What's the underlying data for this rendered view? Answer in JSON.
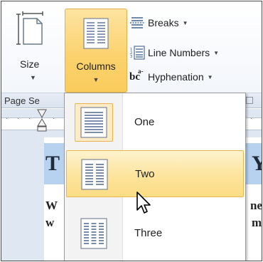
{
  "ribbon": {
    "size_label": "Size",
    "columns_label": "Columns",
    "breaks_label": "Breaks",
    "line_numbers_label": "Line Numbers",
    "hyphenation_label": "Hyphenation",
    "hyphenation_icon_text": "bc",
    "hyphenation_icon_sup": "a-",
    "group_label": "Page Se"
  },
  "columns_menu": {
    "items": [
      {
        "label": "One",
        "icon": "one-column-icon"
      },
      {
        "label": "Two",
        "icon": "two-columns-icon",
        "highlighted": true
      },
      {
        "label": "Three",
        "icon": "three-columns-icon"
      }
    ]
  },
  "document": {
    "heading_left": "T",
    "heading_right": "Y",
    "line1_left": "W",
    "line1_right": "ne",
    "line2_left": "w",
    "line2_right": "m"
  },
  "colors": {
    "highlight": "#fcdc85",
    "heading_band": "#b7d2ee",
    "workspace": "#dfe7f2"
  }
}
